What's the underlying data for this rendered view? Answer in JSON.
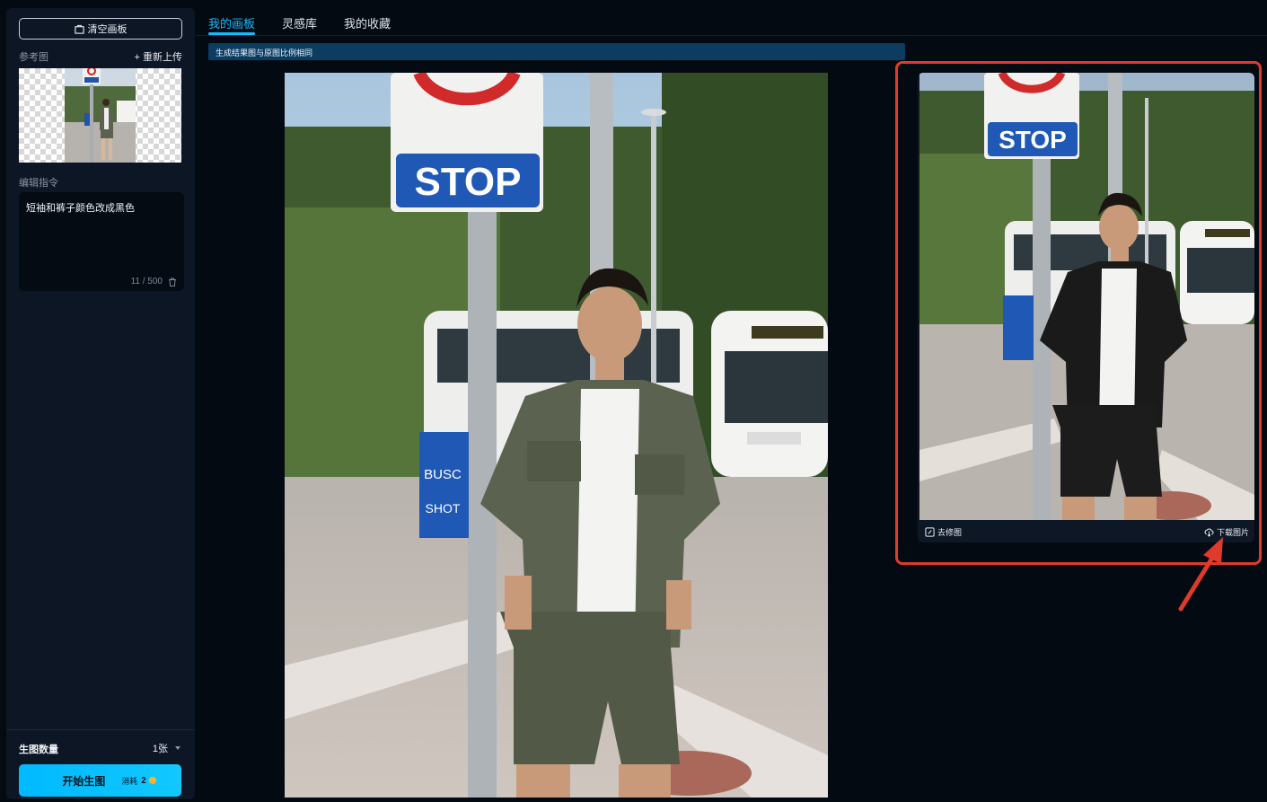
{
  "sidebar": {
    "clear_label": "清空画板",
    "ref_title": "参考图",
    "reupload_label": "+ 重新上传",
    "edit_title": "编辑指令",
    "prompt_text": "短袖和裤子颜色改成黑色",
    "prompt_count": "11 / 500",
    "count_label": "生图数量",
    "count_value": "1张",
    "start_label": "开始生图",
    "cost_label": "消耗",
    "cost_value": "2"
  },
  "tabs": [
    {
      "label": "我的画板",
      "active": true
    },
    {
      "label": "灵感库",
      "active": false
    },
    {
      "label": "我的收藏",
      "active": false
    }
  ],
  "notice": "生成结果图与原图比例相同",
  "sign_text": "STOP",
  "result": {
    "retouch_label": "去修图",
    "download_label": "下载图片"
  },
  "colors": {
    "accent": "#14bbff",
    "highlight_frame": "#e03a2c",
    "shirt_original": "#5b6350",
    "shirt_result": "#1a1a1a"
  }
}
